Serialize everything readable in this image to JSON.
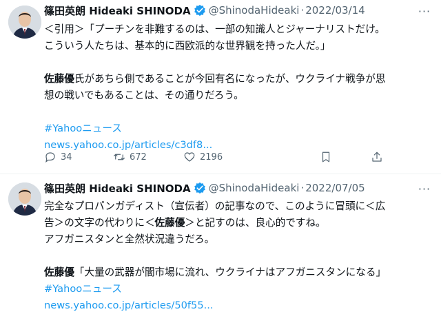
{
  "tweets": [
    {
      "author_name": "篠田英朗 Hideaki SHINODA",
      "handle": "@ShinodaHideaki",
      "separator": "·",
      "date": "2022/03/14",
      "text_lines": [
        "＜引用＞「プーチンを非難するのは、一部の知識人とジャーナリストだけ。",
        "こういう人たちは、基本的に西欧派的な世界観を持った人だ。」",
        "",
        {
          "bold": "佐藤優",
          "rest": "氏があちら側であることが今回有名になったが、ウクライナ戦争が思"
        },
        "想の戦いでもあることは、その通りだろう。",
        ""
      ],
      "hashtag": "#Yahooニュース",
      "url": "news.yahoo.co.jp/articles/c3df8...",
      "replies": "34",
      "retweets": "672",
      "likes": "2196"
    },
    {
      "author_name": "篠田英朗 Hideaki SHINODA",
      "handle": "@ShinodaHideaki",
      "separator": "·",
      "date": "2022/07/05",
      "line1": "完全なプロパンガディスト（宣伝者）の記事なので、このように冒頭に＜広",
      "line2_pre": "告＞の文字の代わりに＜",
      "line2_bold": "佐藤優",
      "line2_post": "＞と記すのは、良心的ですね。",
      "line3": "アフガニスタンと全然状況違うだろ。",
      "line5_bold": "佐藤優",
      "line5_rest": "「大量の武器が闇市場に流れ、ウクライナはアフガニスタンになる」",
      "hashtag": "#Yahooニュース",
      "url": "news.yahoo.co.jp/articles/50f55..."
    }
  ],
  "colors": {
    "link": "#1d9bf0",
    "secondary_text": "#536471",
    "verified_badge": "#1d9bf0"
  },
  "icons": {
    "reply": "reply-icon",
    "retweet": "retweet-icon",
    "like": "heart-icon",
    "bookmark": "bookmark-icon",
    "share": "share-icon",
    "more": "more-icon",
    "verified": "verified-badge-icon"
  },
  "more_glyph": "···"
}
